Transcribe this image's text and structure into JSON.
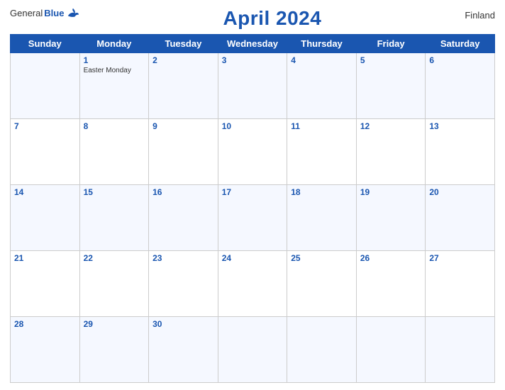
{
  "header": {
    "logo_general": "General",
    "logo_blue": "Blue",
    "title": "April 2024",
    "country": "Finland"
  },
  "days_of_week": [
    "Sunday",
    "Monday",
    "Tuesday",
    "Wednesday",
    "Thursday",
    "Friday",
    "Saturday"
  ],
  "weeks": [
    [
      {
        "num": "",
        "events": []
      },
      {
        "num": "1",
        "events": [
          "Easter Monday"
        ]
      },
      {
        "num": "2",
        "events": []
      },
      {
        "num": "3",
        "events": []
      },
      {
        "num": "4",
        "events": []
      },
      {
        "num": "5",
        "events": []
      },
      {
        "num": "6",
        "events": []
      }
    ],
    [
      {
        "num": "7",
        "events": []
      },
      {
        "num": "8",
        "events": []
      },
      {
        "num": "9",
        "events": []
      },
      {
        "num": "10",
        "events": []
      },
      {
        "num": "11",
        "events": []
      },
      {
        "num": "12",
        "events": []
      },
      {
        "num": "13",
        "events": []
      }
    ],
    [
      {
        "num": "14",
        "events": []
      },
      {
        "num": "15",
        "events": []
      },
      {
        "num": "16",
        "events": []
      },
      {
        "num": "17",
        "events": []
      },
      {
        "num": "18",
        "events": []
      },
      {
        "num": "19",
        "events": []
      },
      {
        "num": "20",
        "events": []
      }
    ],
    [
      {
        "num": "21",
        "events": []
      },
      {
        "num": "22",
        "events": []
      },
      {
        "num": "23",
        "events": []
      },
      {
        "num": "24",
        "events": []
      },
      {
        "num": "25",
        "events": []
      },
      {
        "num": "26",
        "events": []
      },
      {
        "num": "27",
        "events": []
      }
    ],
    [
      {
        "num": "28",
        "events": []
      },
      {
        "num": "29",
        "events": []
      },
      {
        "num": "30",
        "events": []
      },
      {
        "num": "",
        "events": []
      },
      {
        "num": "",
        "events": []
      },
      {
        "num": "",
        "events": []
      },
      {
        "num": "",
        "events": []
      }
    ]
  ]
}
